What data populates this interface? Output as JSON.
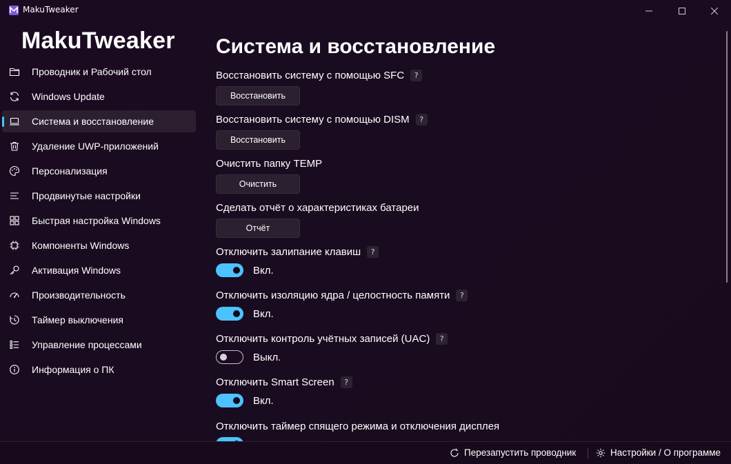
{
  "window": {
    "title": "MakuTweaker",
    "controls": [
      "minimize-icon",
      "maximize-icon",
      "close-icon"
    ]
  },
  "sidebar": {
    "brand": "MakuTweaker",
    "accent_color": "#4cc2ff",
    "items": [
      {
        "label": "Проводник и Рабочий стол",
        "icon": "folder-icon",
        "active": false
      },
      {
        "label": "Windows Update",
        "icon": "refresh-icon",
        "active": false
      },
      {
        "label": "Система и восстановление",
        "icon": "laptop-icon",
        "active": true
      },
      {
        "label": "Удаление UWP-приложений",
        "icon": "trash-icon",
        "active": false
      },
      {
        "label": "Персонализация",
        "icon": "palette-icon",
        "active": false
      },
      {
        "label": "Продвинутые настройки",
        "icon": "lines-icon",
        "active": false
      },
      {
        "label": "Быстрая настройка Windows",
        "icon": "grid-icon",
        "active": false
      },
      {
        "label": "Компоненты Windows",
        "icon": "chip-icon",
        "active": false
      },
      {
        "label": "Активация Windows",
        "icon": "key-icon",
        "active": false
      },
      {
        "label": "Производительность",
        "icon": "gauge-icon",
        "active": false
      },
      {
        "label": "Таймер выключения",
        "icon": "timer-icon",
        "active": false
      },
      {
        "label": "Управление процессами",
        "icon": "list-icon",
        "active": false
      },
      {
        "label": "Информация о ПК",
        "icon": "info-icon",
        "active": false
      }
    ]
  },
  "main": {
    "title": "Система и восстановление",
    "settings": [
      {
        "label": "Восстановить систему с помощью SFC",
        "help": "?",
        "button": "Восстановить"
      },
      {
        "label": "Восстановить систему с помощью DISM",
        "help": "?",
        "button": "Восстановить"
      },
      {
        "label": "Очистить папку TEMP",
        "help": "",
        "button": "Очистить"
      },
      {
        "label": "Сделать отчёт о характеристиках батареи",
        "help": "",
        "button": "Отчёт"
      },
      {
        "label": "Отключить залипание клавиш",
        "help": "?",
        "toggle": true,
        "state": "Вкл."
      },
      {
        "label": "Отключить изоляцию ядра / целостность памяти",
        "help": "?",
        "toggle": true,
        "state": "Вкл."
      },
      {
        "label": "Отключить контроль учётных записей (UAC)",
        "help": "?",
        "toggle": false,
        "state": "Выкл."
      },
      {
        "label": "Отключить Smart Screen",
        "help": "?",
        "toggle": true,
        "state": "Вкл."
      },
      {
        "label": "Отключить таймер спящего режима и отключения дисплея",
        "help": "",
        "toggle": true,
        "state": ""
      }
    ]
  },
  "bottombar": {
    "restart_explorer": "Перезапустить проводник",
    "settings_about": "Настройки / О программе"
  }
}
